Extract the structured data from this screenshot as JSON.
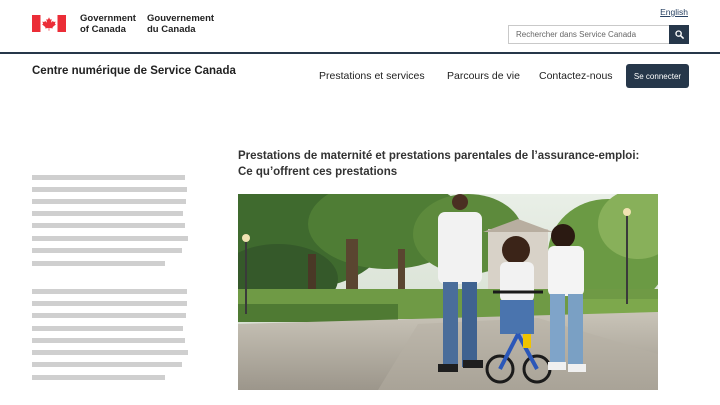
{
  "header": {
    "wordmark_en_line1": "Government",
    "wordmark_en_line2": "of Canada",
    "wordmark_fr_line1": "Gouvernement",
    "wordmark_fr_line2": "du Canada",
    "language_link": "English",
    "search_placeholder": "Rechercher dans Service Canada"
  },
  "service": {
    "title": "Centre numérique de Service Canada",
    "nav": [
      "Prestations et services",
      "Parcours de vie",
      "Contactez-nous"
    ],
    "signin_label": "Se connecter"
  },
  "content": {
    "heading_line1": "Prestations de maternité et prestations parentales de l’assurance-emploi:",
    "heading_line2": "Ce qu’offrent ces prestations"
  },
  "colors": {
    "flag_red": "#eb2d37",
    "primary_navy": "#26374a",
    "placeholder_grey": "#cfcfcf"
  },
  "icons": [
    "canada-flag-icon",
    "search-icon"
  ]
}
